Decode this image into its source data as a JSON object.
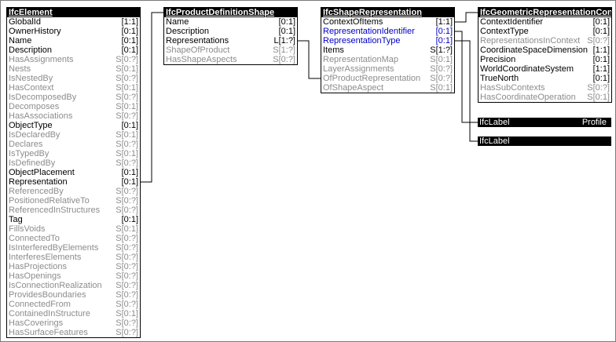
{
  "entities": {
    "ifc_element": {
      "title": "IfcElement",
      "attributes": [
        {
          "name": "GlobalId",
          "card": "[1:1]",
          "style": "normal"
        },
        {
          "name": "OwnerHistory",
          "card": "[0:1]",
          "style": "normal"
        },
        {
          "name": "Name",
          "card": "[0:1]",
          "style": "normal"
        },
        {
          "name": "Description",
          "card": "[0:1]",
          "style": "normal"
        },
        {
          "name": "HasAssignments",
          "card": "S[0:?]",
          "style": "inverse"
        },
        {
          "name": "Nests",
          "card": "S[0:1]",
          "style": "inverse"
        },
        {
          "name": "IsNestedBy",
          "card": "S[0:?]",
          "style": "inverse"
        },
        {
          "name": "HasContext",
          "card": "S[0:1]",
          "style": "inverse"
        },
        {
          "name": "IsDecomposedBy",
          "card": "S[0:?]",
          "style": "inverse"
        },
        {
          "name": "Decomposes",
          "card": "S[0:1]",
          "style": "inverse"
        },
        {
          "name": "HasAssociations",
          "card": "S[0:?]",
          "style": "inverse"
        },
        {
          "name": "ObjectType",
          "card": "[0:1]",
          "style": "normal"
        },
        {
          "name": "IsDeclaredBy",
          "card": "S[0:1]",
          "style": "inverse"
        },
        {
          "name": "Declares",
          "card": "S[0:?]",
          "style": "inverse"
        },
        {
          "name": "IsTypedBy",
          "card": "S[0:1]",
          "style": "inverse"
        },
        {
          "name": "IsDefinedBy",
          "card": "S[0:?]",
          "style": "inverse"
        },
        {
          "name": "ObjectPlacement",
          "card": "[0:1]",
          "style": "normal"
        },
        {
          "name": "Representation",
          "card": "[0:1]",
          "style": "normal"
        },
        {
          "name": "ReferencedBy",
          "card": "S[0:?]",
          "style": "inverse"
        },
        {
          "name": "PositionedRelativeTo",
          "card": "S[0:?]",
          "style": "inverse"
        },
        {
          "name": "ReferencedInStructures",
          "card": "S[0:?]",
          "style": "inverse"
        },
        {
          "name": "Tag",
          "card": "[0:1]",
          "style": "normal"
        },
        {
          "name": "FillsVoids",
          "card": "S[0:1]",
          "style": "inverse"
        },
        {
          "name": "ConnectedTo",
          "card": "S[0:?]",
          "style": "inverse"
        },
        {
          "name": "IsInterferedByElements",
          "card": "S[0:?]",
          "style": "inverse"
        },
        {
          "name": "InterferesElements",
          "card": "S[0:?]",
          "style": "inverse"
        },
        {
          "name": "HasProjections",
          "card": "S[0:?]",
          "style": "inverse"
        },
        {
          "name": "HasOpenings",
          "card": "S[0:?]",
          "style": "inverse"
        },
        {
          "name": "IsConnectionRealization",
          "card": "S[0:?]",
          "style": "inverse"
        },
        {
          "name": "ProvidesBoundaries",
          "card": "S[0:?]",
          "style": "inverse"
        },
        {
          "name": "ConnectedFrom",
          "card": "S[0:?]",
          "style": "inverse"
        },
        {
          "name": "ContainedInStructure",
          "card": "S[0:1]",
          "style": "inverse"
        },
        {
          "name": "HasCoverings",
          "card": "S[0:?]",
          "style": "inverse"
        },
        {
          "name": "HasSurfaceFeatures",
          "card": "S[0:?]",
          "style": "inverse"
        }
      ]
    },
    "ifc_product_definition_shape": {
      "title": "IfcProductDefinitionShape",
      "attributes": [
        {
          "name": "Name",
          "card": "[0:1]",
          "style": "normal"
        },
        {
          "name": "Description",
          "card": "[0:1]",
          "style": "normal"
        },
        {
          "name": "Representations",
          "card": "L[1:?]",
          "style": "normal"
        },
        {
          "name": "ShapeOfProduct",
          "card": "S[1:?]",
          "style": "inverse"
        },
        {
          "name": "HasShapeAspects",
          "card": "S[0:?]",
          "style": "inverse"
        }
      ]
    },
    "ifc_shape_representation": {
      "title": "IfcShapeRepresentation",
      "attributes": [
        {
          "name": "ContextOfItems",
          "card": "[1:1]",
          "style": "normal"
        },
        {
          "name": "RepresentationIdentifier",
          "card": "[0:1]",
          "style": "blue"
        },
        {
          "name": "RepresentationType",
          "card": "[0:1]",
          "style": "blue"
        },
        {
          "name": "Items",
          "card": "S[1:?]",
          "style": "normal"
        },
        {
          "name": "RepresentationMap",
          "card": "S[0:1]",
          "style": "inverse"
        },
        {
          "name": "LayerAssignments",
          "card": "S[0:?]",
          "style": "inverse"
        },
        {
          "name": "OfProductRepresentation",
          "card": "S[0:?]",
          "style": "inverse"
        },
        {
          "name": "OfShapeAspect",
          "card": "S[0:1]",
          "style": "inverse"
        }
      ]
    },
    "ifc_geometric_representation_context": {
      "title": "IfcGeometricRepresentationContext",
      "attributes": [
        {
          "name": "ContextIdentifier",
          "card": "[0:1]",
          "style": "normal"
        },
        {
          "name": "ContextType",
          "card": "[0:1]",
          "style": "normal"
        },
        {
          "name": "RepresentationsInContext",
          "card": "S[0:?]",
          "style": "inverse"
        },
        {
          "name": "CoordinateSpaceDimension",
          "card": "[1:1]",
          "style": "normal"
        },
        {
          "name": "Precision",
          "card": "[0:1]",
          "style": "normal"
        },
        {
          "name": "WorldCoordinateSystem",
          "card": "[1:1]",
          "style": "normal"
        },
        {
          "name": "TrueNorth",
          "card": "[0:1]",
          "style": "normal"
        },
        {
          "name": "HasSubContexts",
          "card": "S[0:?]",
          "style": "inverse"
        },
        {
          "name": "HasCoordinateOperation",
          "card": "S[0:1]",
          "style": "inverse"
        }
      ]
    }
  },
  "labels": {
    "representation_identifier": {
      "type": "IfcLabel",
      "value": "Profile"
    },
    "representation_type": {
      "type": "IfcLabel",
      "value": ""
    }
  },
  "colors": {
    "header_bg": "#000000",
    "inverse_text": "#8c8c8c",
    "highlight_text": "#0000c8"
  }
}
